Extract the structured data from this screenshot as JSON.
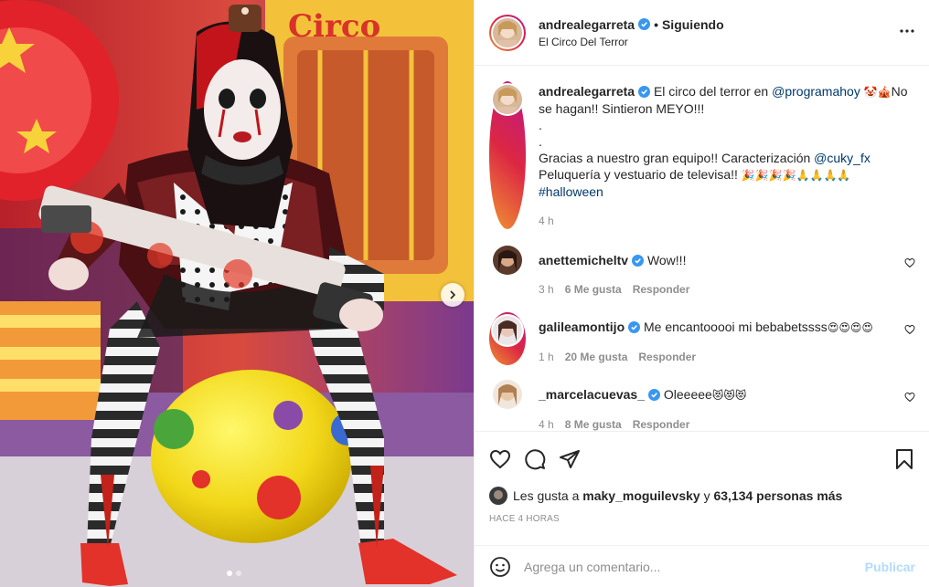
{
  "post": {
    "author": "andrealegarreta",
    "header_separator": "•",
    "follow_status": "Siguiendo",
    "location": "El Circo Del Terror"
  },
  "caption": {
    "username": "andrealegarreta",
    "text_1": "El circo del terror en ",
    "mention_1": "@programahoy",
    "emoji_1": "🤡🎪",
    "text_2": "No se hagan!! Sintieron MEYO!!!",
    "dot_1": ".",
    "dot_2": ".",
    "text_3": "Gracias a nuestro gran equipo!! Caracterización ",
    "mention_2": "@cuky_fx",
    "text_4": "Peluquería y vestuario de televisa!! ",
    "emoji_2": "🎉🎉🎉🎉🙏🙏🙏🙏",
    "hashtag": "#halloween",
    "time": "4 h"
  },
  "comments": [
    {
      "username": "anettemicheltv",
      "text": "Wow!!!",
      "time": "3 h",
      "likes": "6 Me gusta",
      "reply": "Responder"
    },
    {
      "username": "galileamontijo",
      "text": "Me encantooooi mi bebabetssss",
      "emoji": "😍😍😍😍",
      "time": "1 h",
      "likes": "20 Me gusta",
      "reply": "Responder"
    },
    {
      "username": "_marcelacuevas_",
      "text": "Oleeeee",
      "emoji": "😻😻😻",
      "time": "4 h",
      "likes": "8 Me gusta",
      "reply": "Responder"
    }
  ],
  "likes": {
    "prefix": "Les gusta a ",
    "user": "maky_moguilevsky",
    "middle": " y ",
    "count": "63,134 personas más"
  },
  "timestamp": "HACE 4 HORAS",
  "add_comment": {
    "placeholder": "Agrega un comentario...",
    "publish": "Publicar"
  },
  "carousel": {
    "total": 2,
    "current": 1
  },
  "colors": {
    "verified": "#3897f0",
    "mention": "#00376b",
    "publish_disabled": "#b3dbff"
  },
  "icons": [
    "more-icon",
    "heart-icon",
    "comment-icon",
    "share-icon",
    "bookmark-icon",
    "emoji-icon",
    "chevron-right-icon",
    "verified-icon"
  ]
}
